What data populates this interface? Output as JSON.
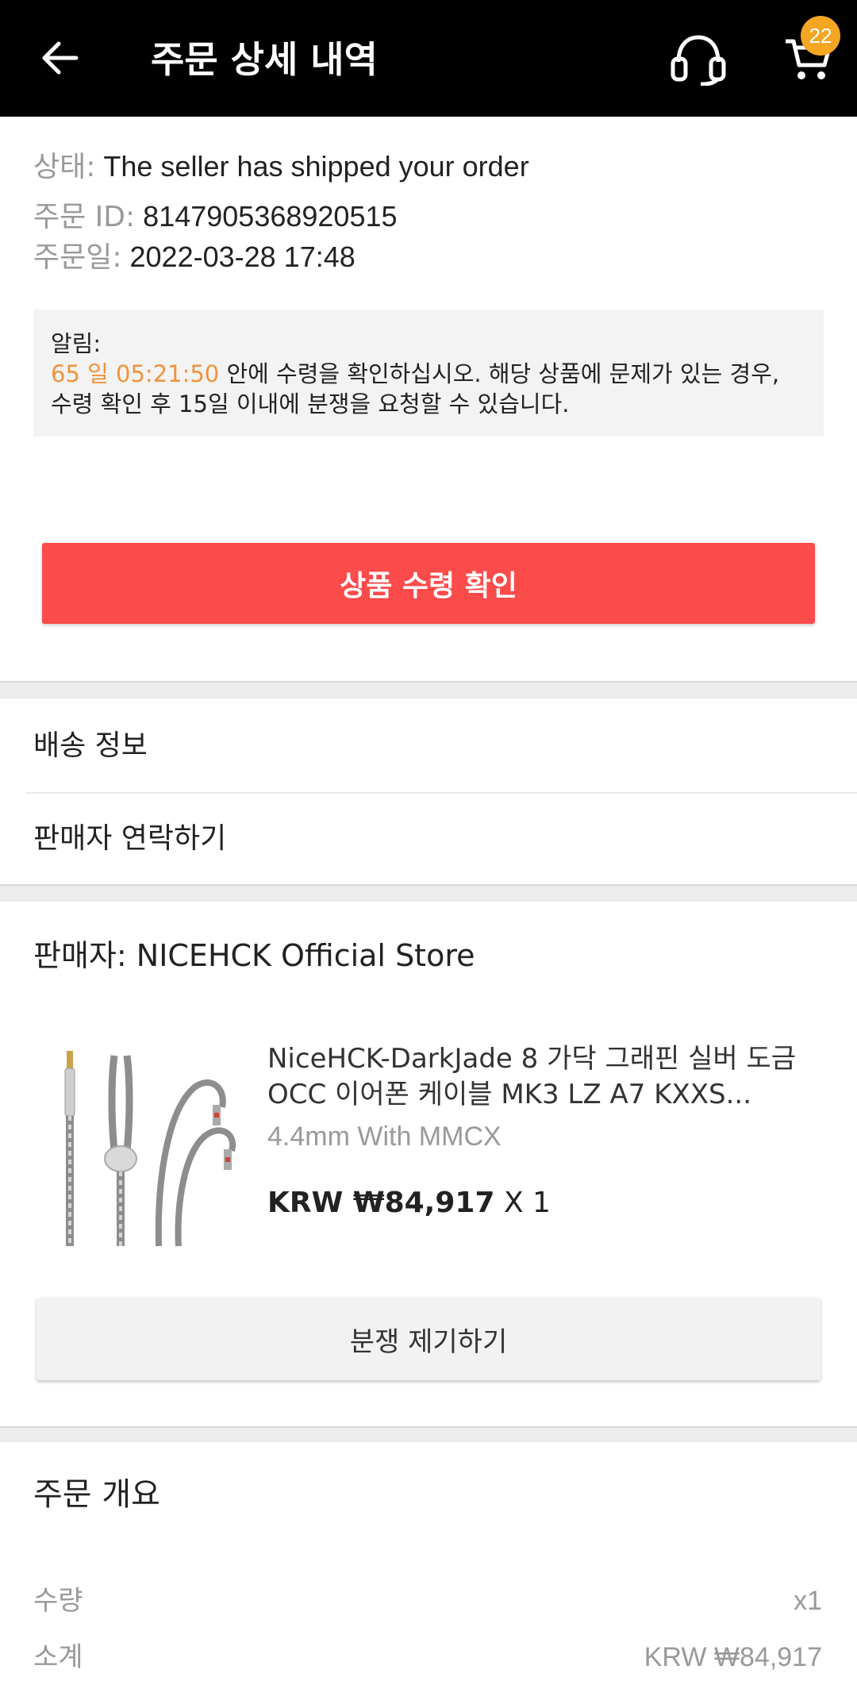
{
  "header": {
    "title": "주문 상세 내역",
    "cart_count": "22"
  },
  "order": {
    "status_label": "상태:",
    "status_value": "The seller has shipped your order",
    "id_label": "주문 ID:",
    "id_value": "8147905368920515",
    "date_label": "주문일:",
    "date_value": "2022-03-28 17:48"
  },
  "notice": {
    "label": "알림:",
    "countdown": "65 일 05:21:50",
    "text_after_countdown": " 안에 수령을 확인하십시오. 해당 상품에 문제가 있는 경우,",
    "text_line3": "수령 확인 후 15일 이내에 분쟁을 요청할 수 있습니다."
  },
  "confirm_button": "상품 수령 확인",
  "menu": {
    "shipping_info": "배송 정보",
    "contact_seller": "판매자 연락하기"
  },
  "seller": {
    "label": "판매자: NICEHCK Official Store"
  },
  "product": {
    "title_line1": "NiceHCK-DarkJade 8 가닥 그래핀 실버 도금",
    "title_line2": "OCC 이어폰 케이블 MK3 LZ A7 KXXS...",
    "variant": "4.4mm With MMCX",
    "price": "KRW ₩84,917",
    "quantity": " X 1"
  },
  "dispute_button": "분쟁 제기하기",
  "summary": {
    "title": "주문 개요",
    "quantity_label": "수량",
    "quantity_value": "x1",
    "subtotal_label": "소계",
    "subtotal_value": "KRW ₩84,917"
  },
  "colors": {
    "topbar": "#000000",
    "accent_red": "#fc4b4b",
    "badge_orange": "#f5a623",
    "countdown_orange": "#f0923a"
  }
}
